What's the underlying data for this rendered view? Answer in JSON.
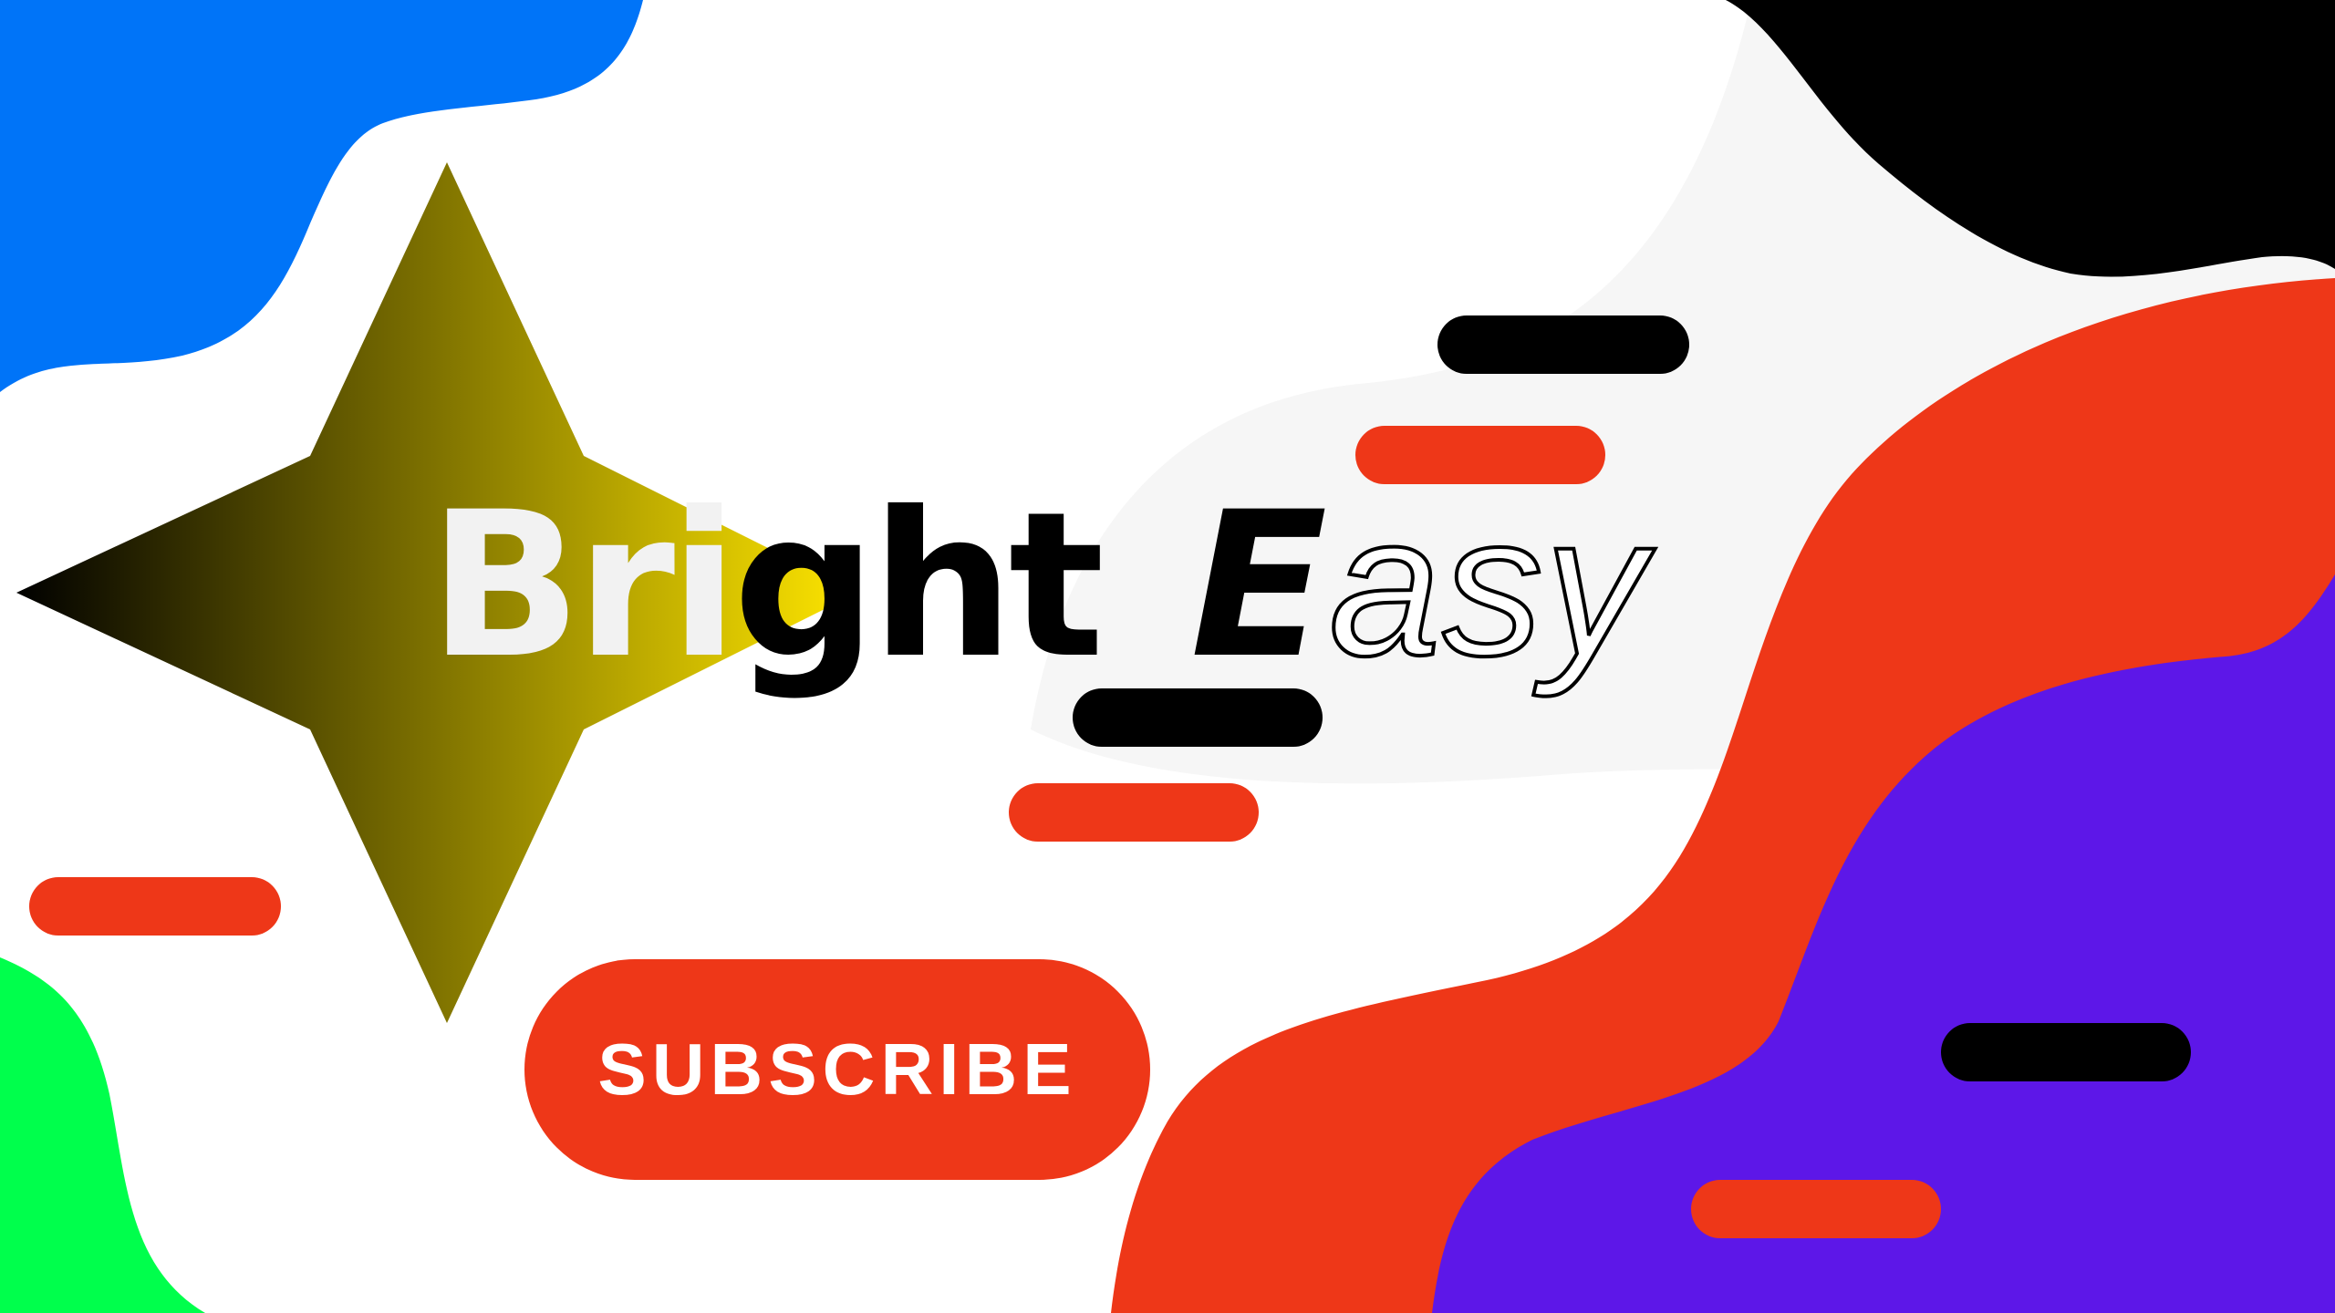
{
  "title": {
    "word1_part_light": "Bri",
    "word1_part_dark": "ght",
    "word2_initial": "E",
    "word2_rest": "asy"
  },
  "cta": {
    "label": "SUBSCRIBE"
  },
  "colors": {
    "blue": "#0074f8",
    "black": "#000000",
    "red": "#ee3718",
    "purple": "#5d17e8",
    "green": "#00ff4c",
    "background": "#ffffff",
    "star_gradient_start": "#000000",
    "star_gradient_end": "#ffe600"
  }
}
